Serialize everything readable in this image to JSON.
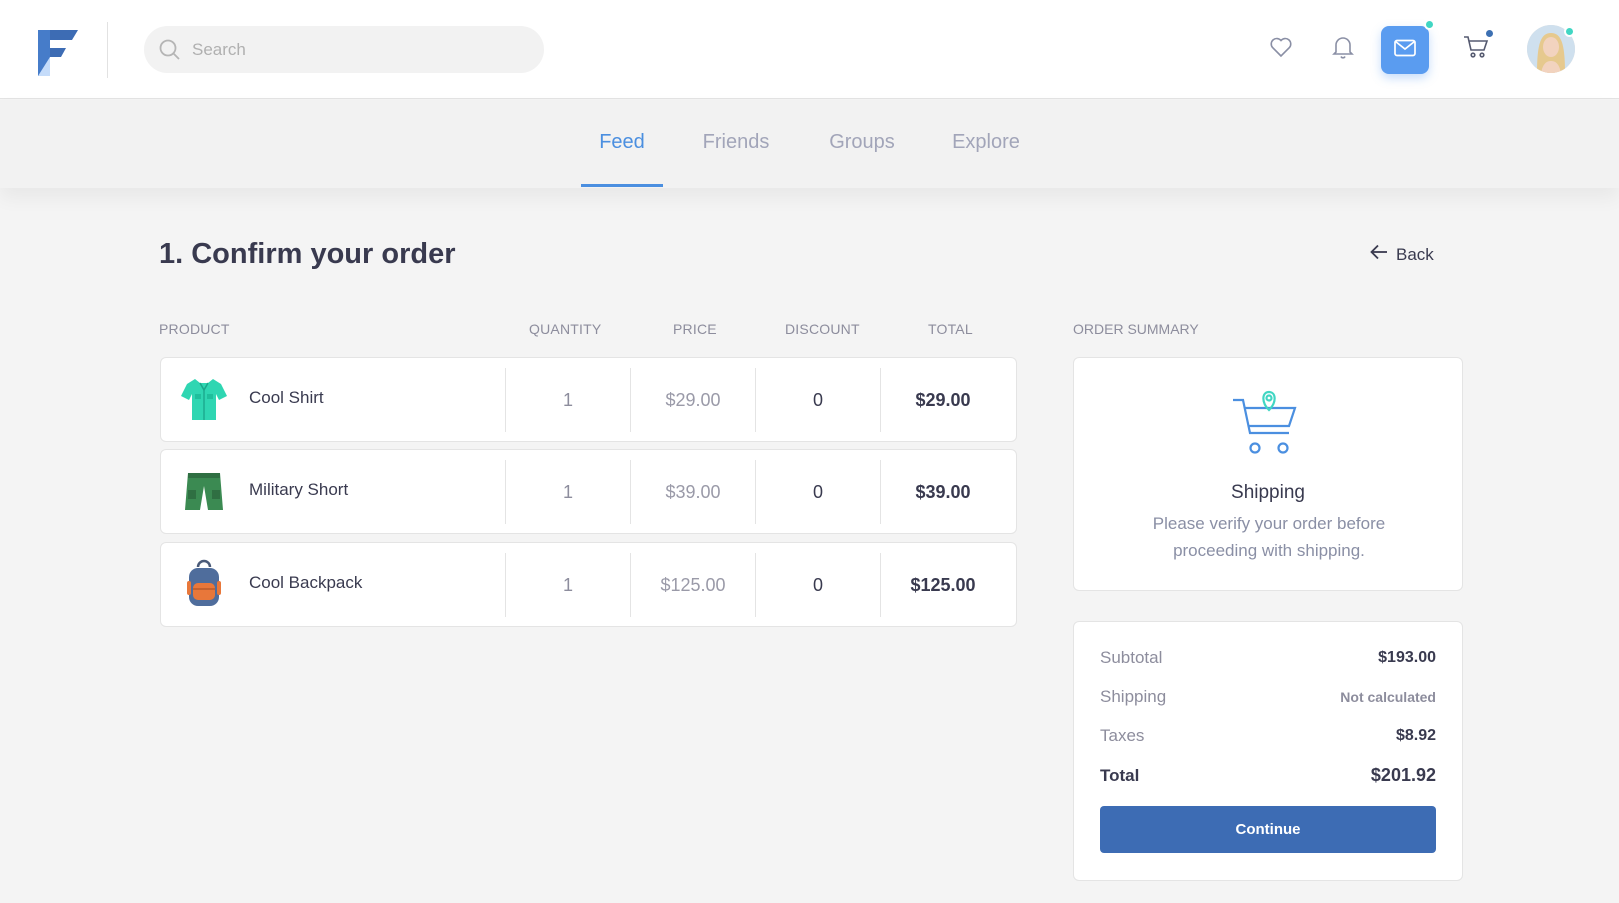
{
  "header": {
    "search_placeholder": "Search"
  },
  "icons": {
    "logo": "logo-f-icon",
    "search": "search-icon",
    "favorites": "heart-icon",
    "notifications": "bell-icon",
    "messages": "mail-icon",
    "cart": "cart-icon"
  },
  "nav": {
    "tabs": [
      {
        "label": "Feed",
        "active": true
      },
      {
        "label": "Friends",
        "active": false
      },
      {
        "label": "Groups",
        "active": false
      },
      {
        "label": "Explore",
        "active": false
      }
    ]
  },
  "page": {
    "title": "1. Confirm your order",
    "back_label": "Back"
  },
  "table": {
    "headers": [
      "PRODUCT",
      "QUANTITY",
      "PRICE",
      "DISCOUNT",
      "TOTAL"
    ],
    "rows": [
      {
        "name": "Cool Shirt",
        "quantity": "1",
        "price": "$29.00",
        "discount": "0",
        "total": "$29.00"
      },
      {
        "name": "Military Short",
        "quantity": "1",
        "price": "$39.00",
        "discount": "0",
        "total": "$39.00"
      },
      {
        "name": "Cool Backpack",
        "quantity": "1",
        "price": "$125.00",
        "discount": "0",
        "total": "$125.00"
      }
    ]
  },
  "summary": {
    "heading": "ORDER SUMMARY",
    "shipping_title": "Shipping",
    "shipping_text": "Please verify your order before proceeding with shipping.",
    "subtotal_label": "Subtotal",
    "subtotal": "$193.00",
    "shipping_label": "Shipping",
    "shipping_value": "Not calculated",
    "taxes_label": "Taxes",
    "taxes": "$8.92",
    "total_label": "Total",
    "total": "$201.92",
    "continue_label": "Continue"
  },
  "colors": {
    "accent": "#4b8fe0",
    "primary_button": "#3d6cb4",
    "mail_badge_bg": "#5a9cf0",
    "online_dot": "#41d6c3",
    "cart_dot": "#3d70b2"
  }
}
